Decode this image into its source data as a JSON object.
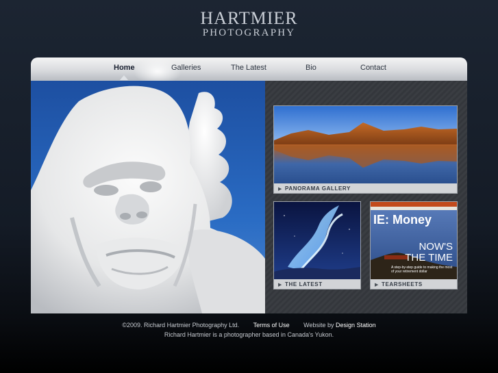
{
  "brand": {
    "line1": "HARTMIER",
    "line2": "PHOTOGRAPHY"
  },
  "nav": [
    {
      "label": "Home",
      "active": true
    },
    {
      "label": "Galleries"
    },
    {
      "label": "The Latest"
    },
    {
      "label": "Bio"
    },
    {
      "label": "Contact"
    }
  ],
  "cards": {
    "panorama": "PANORAMA GALLERY",
    "latest": "THE LATEST",
    "tearsheets": "TEARSHEETS"
  },
  "magazine": {
    "title": "IE: Money",
    "headline1": "NOW'S",
    "headline2": "THE TIME",
    "sub": "A step-by-step guide to making the most of your retirement dollar"
  },
  "footer": {
    "copyright": "©2009. Richard Hartmier Photography Ltd.",
    "terms": "Terms of Use",
    "website_by": "Website by",
    "designer": "Design Station",
    "tagline": "Richard Hartmier is a photographer based in Canada's Yukon."
  },
  "colors": {
    "background": "#1c2532",
    "nav": "#d9dbde",
    "panel": "#3a3d42"
  }
}
